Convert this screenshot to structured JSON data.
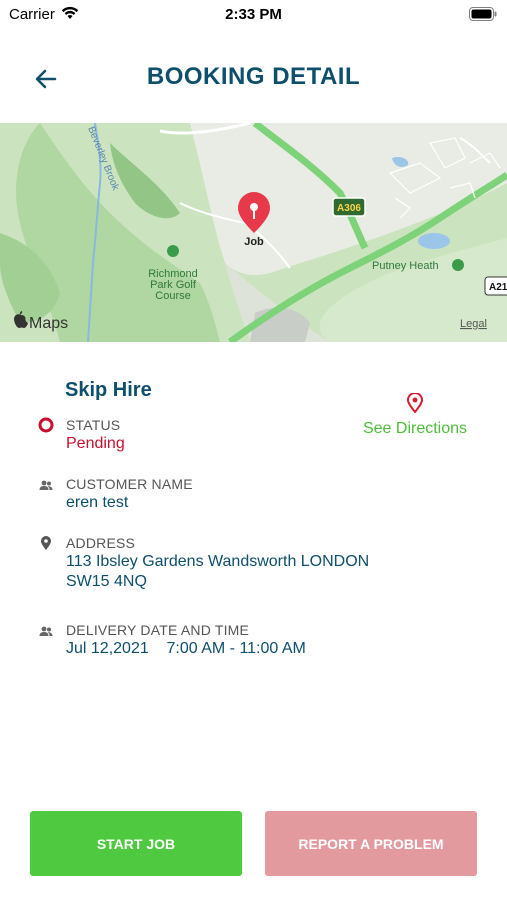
{
  "status_bar": {
    "carrier": "Carrier",
    "time": "2:33 PM"
  },
  "header": {
    "title": "BOOKING DETAIL",
    "back_icon": "arrow-left-icon"
  },
  "map": {
    "pin_label": "Job",
    "labels": {
      "beverley_brook": "Beverley Brook",
      "richmond_1": "Richmond",
      "richmond_2": "Park Golf",
      "richmond_3": "Course",
      "a306": "A306",
      "putney_heath": "Putney Heath",
      "a21": "A21",
      "maps_brand": "Maps",
      "legal": "Legal"
    }
  },
  "booking": {
    "service": "Skip Hire",
    "directions_label": "See Directions",
    "status_label": "STATUS",
    "status_value": "Pending",
    "customer_label": "CUSTOMER NAME",
    "customer_value": "eren test",
    "address_label": "ADDRESS",
    "address_line1": "113 Ibsley Gardens  Wandsworth LONDON",
    "address_line2": "SW15 4NQ",
    "delivery_label": "DELIVERY DATE AND TIME",
    "delivery_value": "Jul 12,2021    7:00 AM - 11:00 AM"
  },
  "actions": {
    "start_job": "START JOB",
    "report_problem": "REPORT A PROBLEM"
  },
  "colors": {
    "title": "#0e4f6b",
    "pending": "#c8102e",
    "green": "#4fc93f",
    "report": "#e39a9f"
  }
}
